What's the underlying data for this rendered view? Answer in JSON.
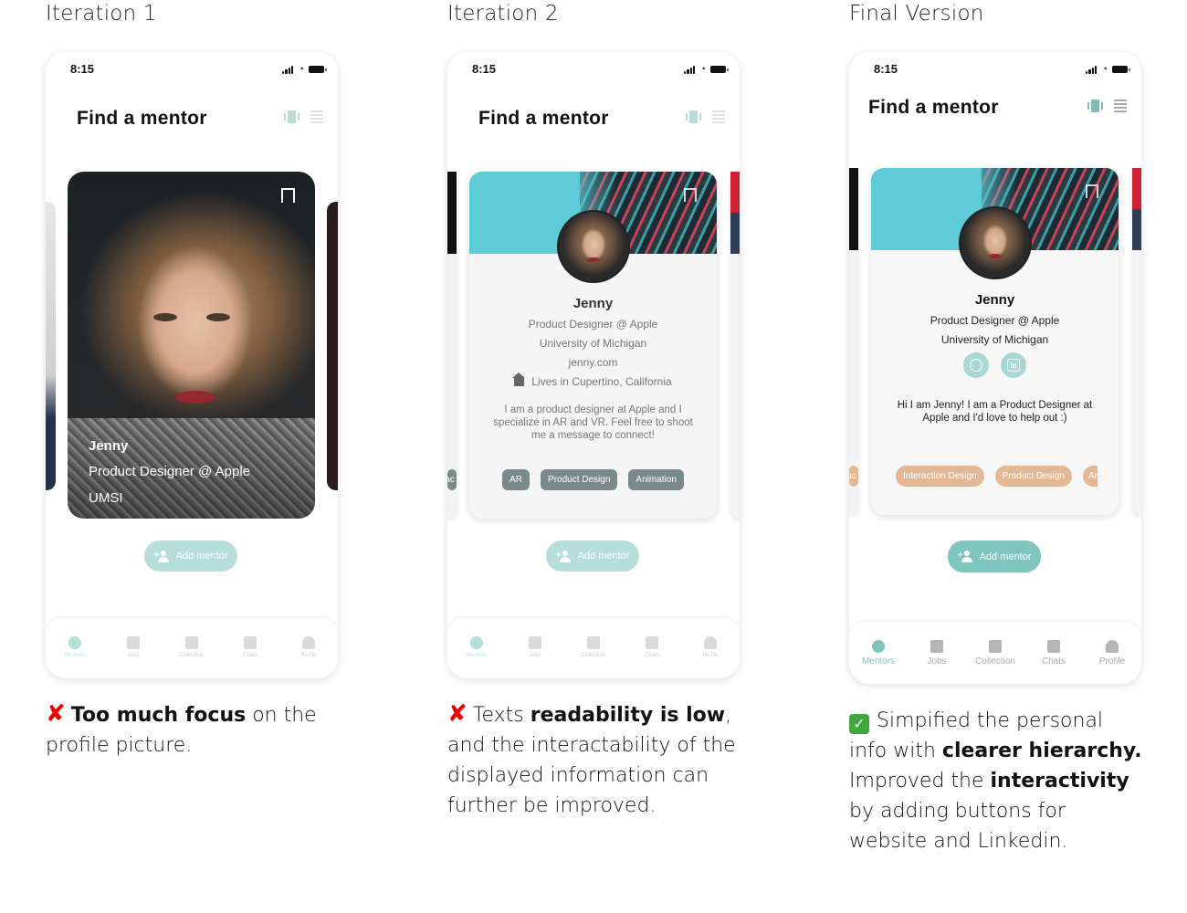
{
  "columns": [
    {
      "title": "Iteration 1",
      "status_time": "8:15",
      "header_title": "Find a mentor",
      "card": {
        "name": "Jenny",
        "role": "Product Designer @ Apple",
        "school": "UMSI"
      },
      "add_button": "Add mentor",
      "tabs": [
        "Mentors",
        "Jobs",
        "Collection",
        "Chats",
        "Profile"
      ],
      "caption": {
        "lead": "Too much focus",
        "rest1": " on the",
        "rest2": "profile picture."
      }
    },
    {
      "title": "Iteration 2",
      "status_time": "8:15",
      "header_title": "Find a mentor",
      "card": {
        "name": "Jenny",
        "role": "Product Designer @ Apple",
        "school": "University of Michigan",
        "website": "jenny.com",
        "location": "Lives in Cupertino, California",
        "bio": "I am a product designer at Apple and I specialize in AR and VR. Feel free to shoot me a message to connect!",
        "tags": [
          "AR",
          "Product Design",
          "Animation"
        ],
        "peek_tag": "rac"
      },
      "add_button": "Add mentor",
      "tabs": [
        "Mentors",
        "Jobs",
        "Collection",
        "Chats",
        "Profile"
      ],
      "caption": {
        "l1a": "Texts ",
        "l1b": "readability is low",
        "l1c": ",",
        "l2": "and the interactability of the",
        "l3": "displayed information can",
        "l4": "further be improved."
      }
    },
    {
      "title": "Final Version",
      "status_time": "8:15",
      "header_title": "Find a mentor",
      "card": {
        "name": "Jenny",
        "role": "Product Designer @ Apple",
        "school": "University of Michigan",
        "bio": "Hi I am Jenny! I am a Product Designer at Apple and I'd love to help out :)",
        "tags": [
          "Interaction Design",
          "Product Design"
        ],
        "peek_tag_left": "rac",
        "peek_tag_right": "An"
      },
      "add_button": "Add mentor",
      "tabs": [
        "Mentors",
        "Jobs",
        "Collection",
        "Chats",
        "Profile"
      ],
      "caption": {
        "l1": "Simpified the personal",
        "l2a": "info with ",
        "l2b": "clearer hierarchy.",
        "l3a": "Improved the ",
        "l3b": "interactivity",
        "l4": "by adding buttons for",
        "l5": "website and Linkedin."
      }
    }
  ],
  "colors": {
    "accent": "#7fc4bd",
    "accent_light": "#b7dfda",
    "tag_final": "#e2b896",
    "tag_iter2": "#7b8a88",
    "error": "#e00000",
    "success": "#3ea83e"
  }
}
